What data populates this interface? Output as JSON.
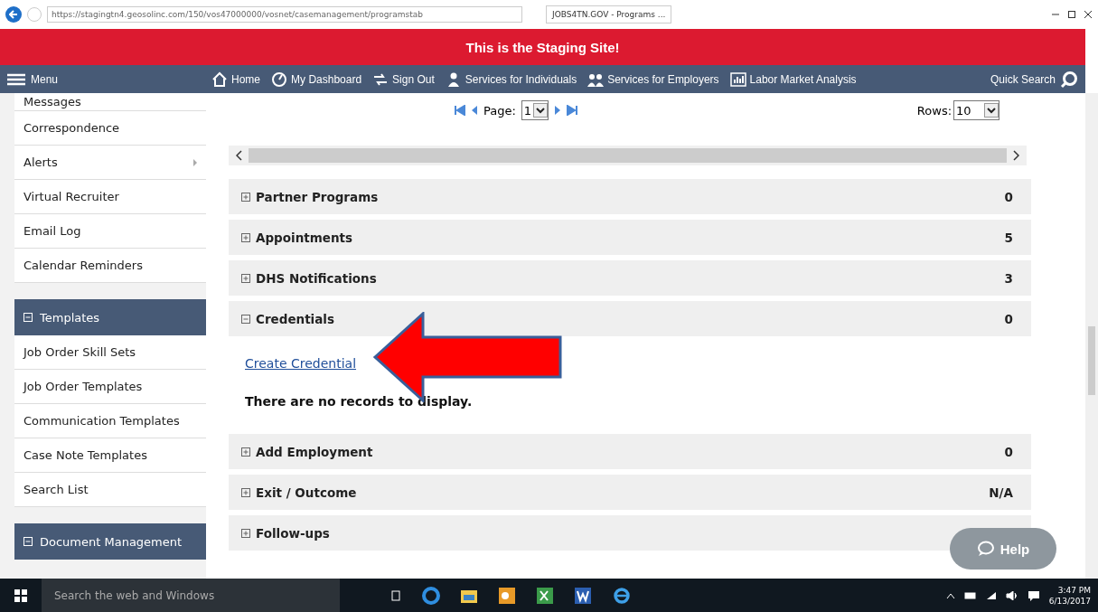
{
  "browser": {
    "url": "https://stagingtn4.geosolinc.com/150/vos47000000/vosnet/casemanagement/programstab",
    "tab_title": "JOBS4TN.GOV - Programs ..."
  },
  "banner": "This is the Staging Site!",
  "nav": {
    "menu": "Menu",
    "items": [
      {
        "kind": "home",
        "label": "Home"
      },
      {
        "kind": "dashboard",
        "label": "My Dashboard"
      },
      {
        "kind": "signout",
        "label": "Sign Out"
      },
      {
        "kind": "person",
        "label": "Services for Individuals"
      },
      {
        "kind": "people",
        "label": "Services for Employers"
      },
      {
        "kind": "chart",
        "label": "Labor Market Analysis"
      }
    ],
    "quick_search": "Quick Search"
  },
  "sidebar": {
    "items": [
      {
        "label": "Messages",
        "submenu": false
      },
      {
        "label": "Correspondence",
        "submenu": false
      },
      {
        "label": "Alerts",
        "submenu": true
      },
      {
        "label": "Virtual Recruiter",
        "submenu": false
      },
      {
        "label": "Email Log",
        "submenu": false
      },
      {
        "label": "Calendar Reminders",
        "submenu": false
      }
    ],
    "groups": [
      {
        "label": "Templates",
        "expanded": true,
        "items": [
          "Job Order Skill Sets",
          "Job Order Templates",
          "Communication Templates",
          "Case Note Templates",
          "Search List"
        ]
      },
      {
        "label": "Document Management",
        "expanded": true
      }
    ]
  },
  "pager": {
    "label": "Page:",
    "page": "1",
    "rows_label": "Rows:",
    "rows": "10"
  },
  "panels": [
    {
      "title": "Partner Programs",
      "count": "0",
      "expanded": false
    },
    {
      "title": "Appointments",
      "count": "5",
      "expanded": false
    },
    {
      "title": "DHS Notifications",
      "count": "3",
      "expanded": false
    },
    {
      "title": "Credentials",
      "count": "0",
      "expanded": true,
      "link": "Create Credential",
      "message": "There are no records to display."
    },
    {
      "title": "Add Employment",
      "count": "0",
      "expanded": false
    },
    {
      "title": "Exit / Outcome",
      "count": "N/A",
      "expanded": false
    },
    {
      "title": "Follow-ups",
      "expanded": false
    }
  ],
  "help": "Help",
  "taskbar": {
    "search": "Search the web and Windows",
    "time": "3:47 PM",
    "date": "6/13/2017"
  }
}
